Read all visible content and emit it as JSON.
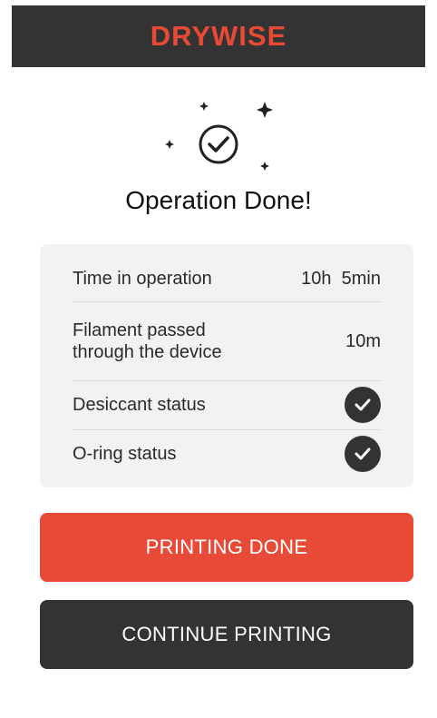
{
  "header": {
    "logo_text": "DRYWISE"
  },
  "status": {
    "title": "Operation Done!"
  },
  "summary": {
    "rows": [
      {
        "label": "Time in operation",
        "value": "10h  5min"
      },
      {
        "label_line1": "Filament passed",
        "label_line2": "through the device",
        "value": "10m"
      },
      {
        "label": "Desiccant status",
        "icon": "check-icon"
      },
      {
        "label": "O-ring status",
        "icon": "check-icon"
      }
    ]
  },
  "actions": {
    "primary_label": "PRINTING DONE",
    "secondary_label": "CONTINUE PRINTING"
  },
  "colors": {
    "brand": "#e84a38",
    "dark": "#333333",
    "card": "#f2f2f2"
  }
}
